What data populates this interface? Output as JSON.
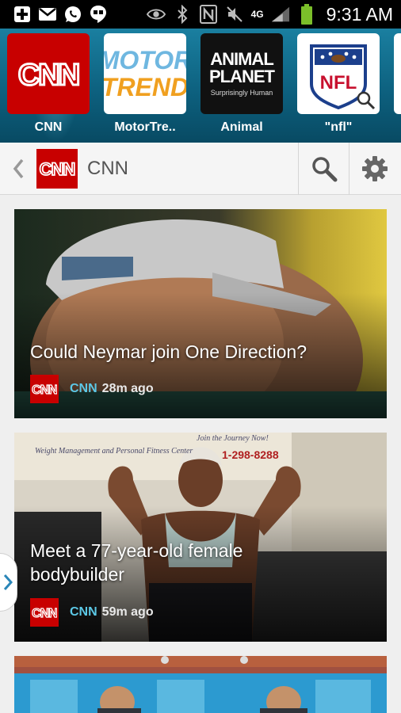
{
  "status_bar": {
    "time": "9:31 AM",
    "network_type": "4G",
    "icons": [
      "plus-icon",
      "gmail-icon",
      "whatsapp-icon",
      "hangouts-icon",
      "eye-icon",
      "bluetooth-icon",
      "nfc-icon",
      "mute-icon",
      "signal-icon",
      "battery-icon"
    ]
  },
  "tiles": [
    {
      "label": "CNN",
      "logo_text": "CNN",
      "bg": "#c80000"
    },
    {
      "label": "MotorTre..",
      "logo_line1": "MOTOR",
      "logo_line2": "TREND",
      "bg": "#ffffff"
    },
    {
      "label": "Animal",
      "logo_line1": "ANIMAL",
      "logo_line2": "PLANET",
      "logo_sub": "Surprisingly Human",
      "bg": "#111111"
    },
    {
      "label": "\"nfl\"",
      "logo_text": "NFL",
      "bg": "#ffffff"
    }
  ],
  "header": {
    "title": "CNN",
    "logo_text": "CNN"
  },
  "feed": [
    {
      "title": "Could Neymar join One Direction?",
      "source": "CNN",
      "time": "28m ago"
    },
    {
      "title_line1": "Meet a 77-year-old female",
      "title_line2": "bodybuilder",
      "source": "CNN",
      "time": "59m ago",
      "banner_text": "Join the Journey Now!",
      "banner_sub": "Weight Management and Personal Fitness Center",
      "banner_phone": "1-298-8288"
    },
    {
      "title": ""
    }
  ],
  "colors": {
    "accent_blue": "#5cc8e6",
    "cnn_red": "#c80000",
    "tile_bar": "#0c5e7c"
  }
}
